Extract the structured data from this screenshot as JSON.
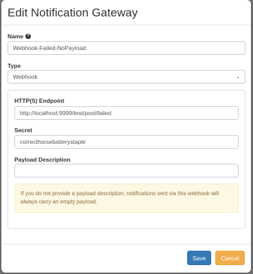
{
  "modal": {
    "title": "Edit Notification Gateway"
  },
  "form": {
    "name_label": "Name",
    "name_value": "Webhook-Failed-NoPayload",
    "type_label": "Type",
    "type_value": "Webhook",
    "endpoint_label": "HTTP(S) Endpoint",
    "endpoint_value": "http://localhost:9999/test/post/failed",
    "secret_label": "Secret",
    "secret_value": "correcthorsebatterystaple",
    "payload_label": "Payload Description",
    "payload_value": "",
    "payload_warning": "If you do not provide a payload description, notifications sent via this webhook will always carry an empty payload."
  },
  "footer": {
    "save_label": "Save",
    "cancel_label": "Cancel"
  },
  "colors": {
    "primary": "#337ab7",
    "warning": "#f0ad4e",
    "alert_bg": "#fcf8e3",
    "alert_text": "#8a6d3b"
  },
  "icons": {
    "help": "question-circle-icon",
    "caret": "chevron-down-icon"
  }
}
